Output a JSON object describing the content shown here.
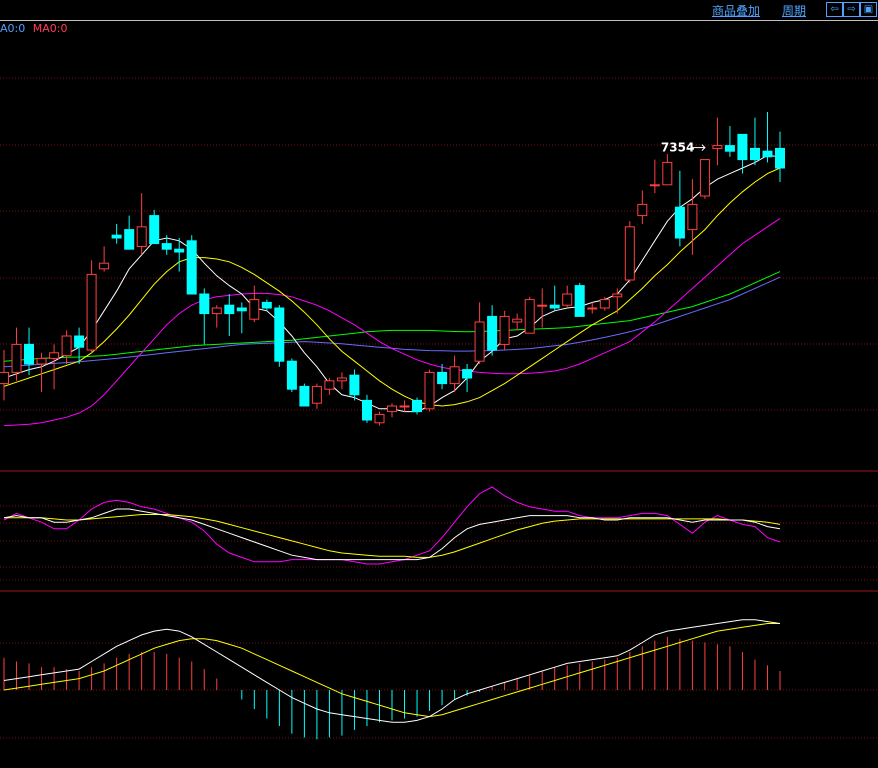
{
  "toolbar": {
    "overlay_label": "商品叠加",
    "period_label": "周期",
    "buttons": [
      {
        "icon": "arrow-left-icon",
        "glyph": "⇦"
      },
      {
        "icon": "arrow-right-icon",
        "glyph": "⇨"
      },
      {
        "icon": "window-icon",
        "glyph": "▣"
      }
    ]
  },
  "ma_legend": {
    "ma1": "A0:0",
    "ma2": "MA0:0",
    "ma1_color": "#4fa3ff",
    "ma2_color": "#ff3b5b"
  },
  "colors": {
    "up": "#ff4040",
    "down": "#00ffff",
    "grid": "#7a1010",
    "ma5": "#ffffff",
    "ma10": "#ffff00",
    "ma20": "#ff00ff",
    "ma60": "#00ff00",
    "ma_long": "#6a6aff"
  },
  "chart_data": [
    {
      "type": "candlestick",
      "title": "",
      "annotation": {
        "label": "7354",
        "index": 56
      },
      "ylim": [
        6000,
        7500
      ],
      "ohlc": [
        [
          6280,
          6400,
          6220,
          6320
        ],
        [
          6320,
          6480,
          6290,
          6420
        ],
        [
          6420,
          6480,
          6310,
          6350
        ],
        [
          6350,
          6390,
          6250,
          6370
        ],
        [
          6370,
          6420,
          6260,
          6390
        ],
        [
          6380,
          6470,
          6350,
          6450
        ],
        [
          6450,
          6480,
          6350,
          6410
        ],
        [
          6400,
          6720,
          6390,
          6670
        ],
        [
          6690,
          6770,
          6680,
          6710
        ],
        [
          6810,
          6850,
          6780,
          6800
        ],
        [
          6830,
          6880,
          6760,
          6760
        ],
        [
          6770,
          6960,
          6740,
          6840
        ],
        [
          6880,
          6900,
          6790,
          6780
        ],
        [
          6780,
          6810,
          6740,
          6760
        ],
        [
          6760,
          6800,
          6680,
          6750
        ],
        [
          6790,
          6810,
          6600,
          6600
        ],
        [
          6600,
          6620,
          6420,
          6530
        ],
        [
          6530,
          6560,
          6480,
          6550
        ],
        [
          6560,
          6600,
          6450,
          6530
        ],
        [
          6550,
          6570,
          6460,
          6540
        ],
        [
          6510,
          6630,
          6500,
          6580
        ],
        [
          6570,
          6580,
          6540,
          6550
        ],
        [
          6550,
          6560,
          6340,
          6360
        ],
        [
          6360,
          6370,
          6250,
          6260
        ],
        [
          6270,
          6280,
          6200,
          6200
        ],
        [
          6210,
          6280,
          6190,
          6270
        ],
        [
          6260,
          6300,
          6240,
          6290
        ],
        [
          6290,
          6320,
          6260,
          6300
        ],
        [
          6310,
          6330,
          6220,
          6240
        ],
        [
          6220,
          6240,
          6140,
          6150
        ],
        [
          6140,
          6180,
          6130,
          6170
        ],
        [
          6180,
          6210,
          6160,
          6200
        ],
        [
          6200,
          6220,
          6180,
          6200
        ],
        [
          6220,
          6230,
          6170,
          6180
        ],
        [
          6190,
          6330,
          6180,
          6320
        ],
        [
          6320,
          6350,
          6260,
          6280
        ],
        [
          6280,
          6380,
          6250,
          6340
        ],
        [
          6330,
          6350,
          6250,
          6300
        ],
        [
          6360,
          6570,
          6350,
          6500
        ],
        [
          6520,
          6560,
          6380,
          6400
        ],
        [
          6420,
          6540,
          6400,
          6520
        ],
        [
          6500,
          6530,
          6470,
          6510
        ],
        [
          6460,
          6590,
          6460,
          6580
        ],
        [
          6560,
          6620,
          6480,
          6560
        ],
        [
          6560,
          6630,
          6540,
          6550
        ],
        [
          6560,
          6630,
          6550,
          6600
        ],
        [
          6630,
          6640,
          6540,
          6520
        ],
        [
          6550,
          6570,
          6530,
          6550
        ],
        [
          6550,
          6590,
          6540,
          6580
        ],
        [
          6590,
          6620,
          6530,
          6600
        ],
        [
          6650,
          6860,
          6640,
          6840
        ],
        [
          6880,
          6970,
          6850,
          6920
        ],
        [
          6990,
          7080,
          6960,
          6990
        ],
        [
          6990,
          7100,
          6990,
          7070
        ],
        [
          6910,
          7040,
          6770,
          6800
        ],
        [
          6830,
          7010,
          6740,
          6920
        ],
        [
          6950,
          7080,
          6940,
          7080
        ],
        [
          7120,
          7230,
          7060,
          7130
        ],
        [
          7130,
          7200,
          7090,
          7110
        ],
        [
          7170,
          7130,
          7030,
          7080
        ],
        [
          7120,
          7230,
          7060,
          7080
        ],
        [
          7110,
          7250,
          7070,
          7090
        ],
        [
          7120,
          7180,
          7000,
          7050
        ]
      ],
      "ma5": [
        6300,
        6315,
        6330,
        6340,
        6360,
        6385,
        6410,
        6470,
        6540,
        6610,
        6690,
        6740,
        6790,
        6800,
        6790,
        6760,
        6710,
        6665,
        6630,
        6600,
        6550,
        6540,
        6500,
        6450,
        6390,
        6340,
        6280,
        6240,
        6230,
        6210,
        6190,
        6190,
        6180,
        6180,
        6200,
        6230,
        6255,
        6300,
        6360,
        6395,
        6440,
        6450,
        6480,
        6520,
        6540,
        6550,
        6555,
        6570,
        6580,
        6600,
        6650,
        6720,
        6790,
        6860,
        6910,
        6940,
        6980,
        7010,
        7030,
        7050,
        7070,
        7095,
        7090
      ],
      "ma10": [
        6270,
        6285,
        6300,
        6315,
        6330,
        6345,
        6360,
        6390,
        6430,
        6475,
        6525,
        6580,
        6635,
        6680,
        6715,
        6730,
        6730,
        6725,
        6715,
        6695,
        6670,
        6640,
        6610,
        6575,
        6535,
        6490,
        6440,
        6395,
        6360,
        6325,
        6290,
        6260,
        6235,
        6215,
        6205,
        6200,
        6205,
        6215,
        6230,
        6255,
        6280,
        6310,
        6340,
        6370,
        6400,
        6430,
        6460,
        6490,
        6515,
        6540,
        6580,
        6620,
        6665,
        6705,
        6750,
        6790,
        6830,
        6880,
        6925,
        6965,
        7000,
        7030,
        7050
      ],
      "ma20": [
        6130,
        6132,
        6135,
        6140,
        6150,
        6160,
        6175,
        6200,
        6240,
        6290,
        6340,
        6390,
        6440,
        6490,
        6530,
        6560,
        6580,
        6590,
        6595,
        6600,
        6602,
        6602,
        6598,
        6590,
        6575,
        6560,
        6540,
        6515,
        6490,
        6460,
        6430,
        6405,
        6385,
        6365,
        6350,
        6338,
        6330,
        6325,
        6320,
        6317,
        6315,
        6315,
        6317,
        6320,
        6325,
        6335,
        6350,
        6370,
        6390,
        6410,
        6430,
        6465,
        6500,
        6540,
        6580,
        6620,
        6660,
        6700,
        6740,
        6780,
        6810,
        6840,
        6870
      ],
      "ma60": [
        6360,
        6363,
        6367,
        6370,
        6372,
        6374,
        6375,
        6378,
        6380,
        6385,
        6390,
        6395,
        6400,
        6405,
        6410,
        6415,
        6418,
        6420,
        6423,
        6425,
        6427,
        6430,
        6433,
        6435,
        6440,
        6445,
        6450,
        6455,
        6460,
        6465,
        6468,
        6470,
        6470,
        6470,
        6470,
        6468,
        6466,
        6465,
        6466,
        6468,
        6470,
        6472,
        6474,
        6476,
        6478,
        6480,
        6485,
        6490,
        6495,
        6500,
        6505,
        6515,
        6525,
        6535,
        6545,
        6555,
        6570,
        6585,
        6600,
        6620,
        6640,
        6660,
        6680
      ],
      "ma_long": [
        6340,
        6343,
        6346,
        6349,
        6352,
        6355,
        6358,
        6362,
        6366,
        6370,
        6375,
        6380,
        6385,
        6390,
        6395,
        6400,
        6405,
        6410,
        6415,
        6420,
        6422,
        6424,
        6426,
        6428,
        6430,
        6428,
        6425,
        6422,
        6418,
        6414,
        6410,
        6406,
        6402,
        6400,
        6398,
        6397,
        6396,
        6396,
        6397,
        6398,
        6400,
        6402,
        6405,
        6410,
        6415,
        6420,
        6428,
        6436,
        6445,
        6455,
        6465,
        6478,
        6490,
        6505,
        6520,
        6535,
        6550,
        6565,
        6580,
        6600,
        6620,
        6640,
        6660
      ]
    },
    {
      "type": "line",
      "title": "",
      "ylim": [
        0,
        100
      ],
      "series": [
        {
          "color": "#ffffff",
          "values": [
            62,
            64,
            62,
            62,
            58,
            58,
            60,
            62,
            66,
            70,
            70,
            68,
            66,
            64,
            62,
            60,
            56,
            52,
            48,
            44,
            40,
            36,
            32,
            28,
            26,
            24,
            24,
            24,
            24,
            24,
            24,
            24,
            24,
            24,
            26,
            34,
            44,
            52,
            56,
            58,
            60,
            62,
            64,
            64,
            64,
            64,
            62,
            62,
            60,
            60,
            62,
            62,
            62,
            62,
            60,
            58,
            60,
            60,
            60,
            60,
            58,
            54,
            52
          ]
        },
        {
          "color": "#ffff00",
          "values": [
            62,
            62,
            62,
            62,
            61,
            60,
            60,
            61,
            62,
            63,
            64,
            65,
            65,
            65,
            64,
            63,
            61,
            59,
            56,
            53,
            50,
            47,
            44,
            41,
            38,
            35,
            32,
            30,
            29,
            28,
            27,
            27,
            27,
            26,
            26,
            28,
            31,
            35,
            39,
            43,
            47,
            51,
            54,
            57,
            59,
            60,
            61,
            61,
            61,
            61,
            61,
            61,
            61,
            61,
            61,
            61,
            61,
            61,
            60,
            60,
            59,
            58,
            56
          ]
        },
        {
          "color": "#ff00ff",
          "values": [
            60,
            66,
            62,
            58,
            52,
            52,
            60,
            70,
            76,
            78,
            76,
            72,
            70,
            66,
            62,
            58,
            50,
            38,
            30,
            26,
            22,
            22,
            22,
            24,
            24,
            24,
            24,
            24,
            22,
            20,
            20,
            22,
            24,
            28,
            32,
            44,
            58,
            72,
            84,
            90,
            82,
            76,
            72,
            70,
            68,
            68,
            64,
            62,
            62,
            62,
            64,
            66,
            66,
            64,
            56,
            48,
            58,
            64,
            60,
            56,
            54,
            44,
            40
          ]
        }
      ]
    },
    {
      "type": "bar+line",
      "title": "",
      "ylim": [
        -100,
        100
      ],
      "macd_hist": [
        34,
        30,
        28,
        24,
        24,
        22,
        20,
        24,
        28,
        34,
        38,
        40,
        40,
        38,
        34,
        30,
        22,
        12,
        0,
        -10,
        -20,
        -30,
        -38,
        -46,
        -50,
        -52,
        -50,
        -48,
        -42,
        -38,
        -34,
        -32,
        -30,
        -28,
        -22,
        -16,
        -10,
        -6,
        -2,
        4,
        8,
        12,
        16,
        20,
        24,
        26,
        28,
        30,
        32,
        34,
        40,
        46,
        52,
        56,
        54,
        52,
        50,
        48,
        46,
        40,
        32,
        26,
        20
      ],
      "dif": [
        10,
        12,
        14,
        16,
        18,
        20,
        22,
        30,
        38,
        46,
        52,
        58,
        62,
        64,
        62,
        56,
        48,
        40,
        32,
        24,
        16,
        8,
        0,
        -8,
        -14,
        -20,
        -24,
        -26,
        -28,
        -30,
        -32,
        -34,
        -34,
        -32,
        -28,
        -20,
        -10,
        -4,
        0,
        4,
        8,
        12,
        16,
        20,
        24,
        28,
        30,
        32,
        34,
        36,
        42,
        50,
        58,
        62,
        64,
        66,
        68,
        70,
        72,
        74,
        74,
        72,
        70
      ],
      "dea": [
        0,
        2,
        4,
        6,
        8,
        10,
        12,
        16,
        20,
        26,
        32,
        38,
        44,
        48,
        52,
        54,
        54,
        52,
        48,
        44,
        38,
        32,
        26,
        20,
        14,
        8,
        2,
        -4,
        -8,
        -12,
        -16,
        -20,
        -24,
        -26,
        -28,
        -26,
        -22,
        -18,
        -14,
        -10,
        -6,
        -2,
        2,
        6,
        10,
        14,
        18,
        22,
        26,
        30,
        34,
        38,
        42,
        46,
        50,
        54,
        58,
        62,
        64,
        66,
        68,
        70,
        70
      ]
    }
  ]
}
